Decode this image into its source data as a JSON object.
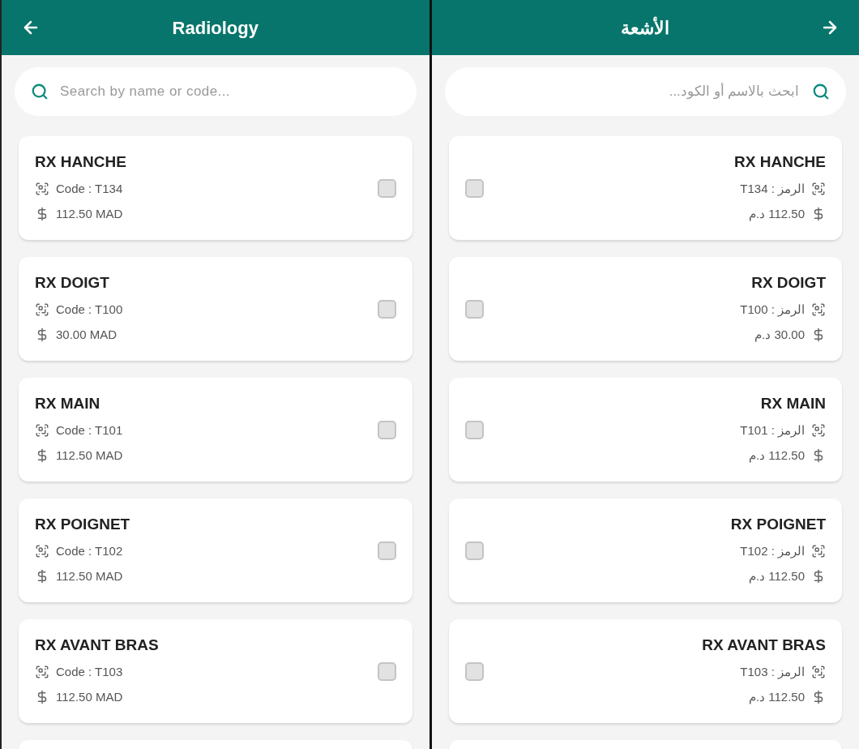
{
  "left_panel": {
    "kind": "ltr",
    "title": "Radiology",
    "search": {
      "placeholder": "Search by name or code..."
    },
    "items": [
      {
        "name": "RX HANCHE",
        "code": "Code : T134",
        "price": "112.50 MAD",
        "checked": false
      },
      {
        "name": "RX DOIGT",
        "code": "Code : T100",
        "price": "30.00 MAD",
        "checked": false
      },
      {
        "name": "RX MAIN",
        "code": "Code : T101",
        "price": "112.50 MAD",
        "checked": false
      },
      {
        "name": "RX POIGNET",
        "code": "Code : T102",
        "price": "112.50 MAD",
        "checked": false
      },
      {
        "name": "RX AVANT BRAS",
        "code": "Code : T103",
        "price": "112.50 MAD",
        "checked": false
      }
    ]
  },
  "right_panel": {
    "kind": "rtl",
    "title": "الأشعة",
    "search": {
      "placeholder": "ابحث بالاسم أو الكود..."
    },
    "items": [
      {
        "name": "RX HANCHE",
        "code": "الرمز : T134",
        "price": "112.50 د.م",
        "checked": false
      },
      {
        "name": "RX DOIGT",
        "code": "الرمز : T100",
        "price": "30.00 د.م",
        "checked": false
      },
      {
        "name": "RX MAIN",
        "code": "الرمز : T101",
        "price": "112.50 د.م",
        "checked": false
      },
      {
        "name": "RX POIGNET",
        "code": "الرمز : T102",
        "price": "112.50 د.م",
        "checked": false
      },
      {
        "name": "RX AVANT BRAS",
        "code": "الرمز : T103",
        "price": "112.50 د.م",
        "checked": false
      }
    ]
  }
}
